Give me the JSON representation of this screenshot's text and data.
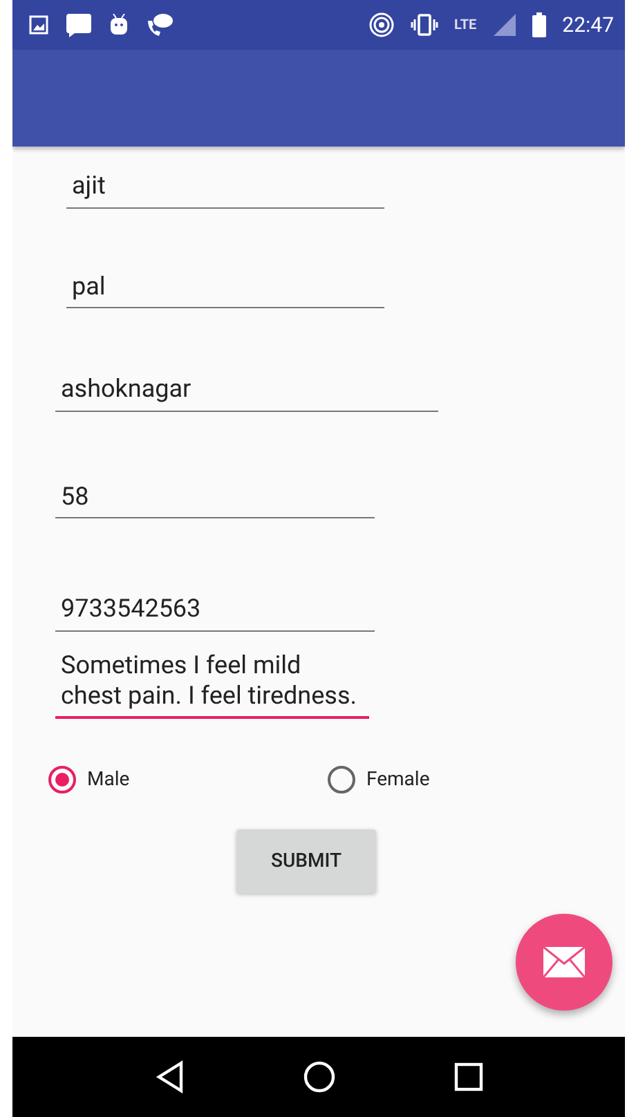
{
  "status_bar": {
    "time": "22:47",
    "network": "LTE"
  },
  "fields": [
    {
      "value": "ajit",
      "focused": false
    },
    {
      "value": "pal",
      "focused": false
    },
    {
      "value": "ashoknagar",
      "focused": false
    },
    {
      "value": "58",
      "focused": false
    },
    {
      "value": "9733542563",
      "focused": false
    },
    {
      "value": "Sometimes I feel mild chest pain. I feel tiredness.",
      "focused": true
    }
  ],
  "gender": [
    {
      "label": "Male",
      "selected": true
    },
    {
      "label": "Female",
      "selected": false
    }
  ],
  "submit": "SUBMIT"
}
